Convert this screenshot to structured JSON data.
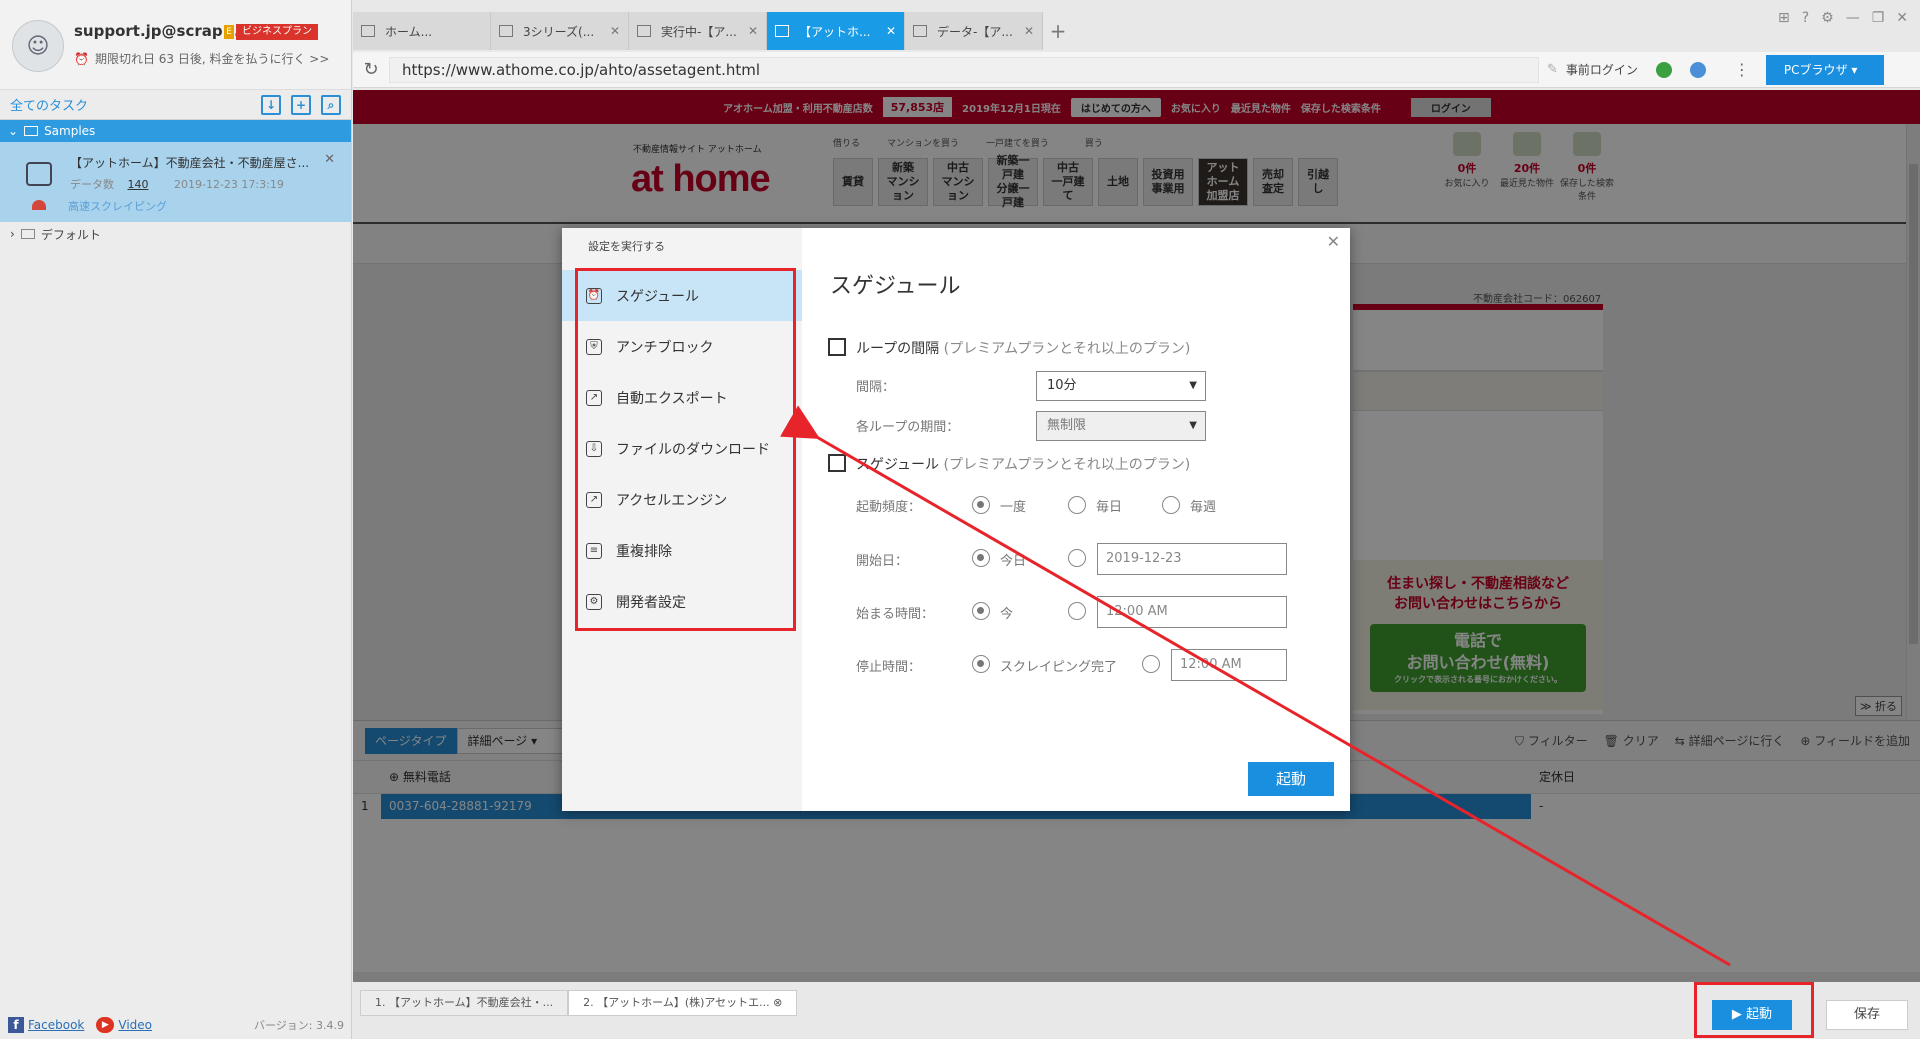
{
  "account": {
    "email": "support.jp@scrap...",
    "plan_tag": "E",
    "plan": "ビジネスプラン",
    "expiry": "期限切れ日 63 日後, 料金を払うに行く >>"
  },
  "sidebar": {
    "all_tasks": "全てのタスク",
    "folder_samples": "Samples",
    "task_name": "【アットホーム】不動産会社・不動産屋さ...",
    "task_data_label": "データ数",
    "task_data_count": "140",
    "task_date": "2019-12-23 17:3:19",
    "task_mode": "高速スクレイピング",
    "folder_default": "デフォルト",
    "footer": {
      "facebook": "Facebook",
      "video": "Video",
      "version": "バージョン: 3.4.9"
    }
  },
  "tabs": [
    {
      "label": "ホーム..."
    },
    {
      "label": "3シリーズ(..."
    },
    {
      "label": "実行中-【ア..."
    },
    {
      "label": "【アットホ..."
    },
    {
      "label": "データ-【ア..."
    }
  ],
  "address": {
    "url": "https://www.athome.co.jp/ahto/assetagent.html",
    "pre_login": "事前ログイン",
    "browser_mode": "PCブラウザ"
  },
  "site": {
    "top_msg": "アオホーム加盟・利用不動産店数",
    "store_count": "57,853店",
    "date_note": "2019年12月1日現在",
    "first_time": "はじめての方へ",
    "favorites": "お気に入り",
    "recent": "最近見た物件",
    "saved_search": "保存した検索条件",
    "login": "ログイン",
    "logo_sub": "不動産情報サイト アットホーム",
    "logo": "at home",
    "nav_header": "借りる　　　マンションを買う　　　一戸建てを買う　　　　買う",
    "nav": [
      "賃貸",
      "新築\nマンション",
      "中古\nマンション",
      "新築一戸建\n分譲一戸建",
      "中古\n一戸建て",
      "土地",
      "投資用\n事業用",
      "アットホーム\n加盟店",
      "売却査定",
      "引越し"
    ],
    "mini": [
      {
        "count": "0件",
        "label": "お気に入り"
      },
      {
        "count": "20件",
        "label": "最近見た物件"
      },
      {
        "count": "0件",
        "label": "保存した検索条件"
      }
    ],
    "corp_code": "不動産会社コード：062607",
    "ad_text": "住まい探し・不動産相談など\nお問い合わせはこちらから",
    "ad_btn": "電話で\nお問い合わせ(無料)",
    "ad_small": "クリックで表示される番号におかけください。",
    "fold": "≫ 折る"
  },
  "data_pane": {
    "page_type": "ページタイプ",
    "detail_page": "詳細ページ",
    "tools": [
      "フィルター",
      "クリア",
      "詳細ページに行く",
      "フィールドを追加"
    ],
    "columns": [
      "無料電話",
      "定休日"
    ],
    "rows": [
      {
        "index": "1",
        "phone": "0037-604-28881-92179",
        "holiday": "-"
      }
    ]
  },
  "bottom_tabs": [
    "1. 【アットホーム】不動産会社・...",
    "2. 【アットホーム】(株)アセットエ..."
  ],
  "buttons": {
    "start": "▶ 起動",
    "save": "保存"
  },
  "dialog": {
    "caption": "設定を実行する",
    "title": "スゲジュール",
    "menu": [
      {
        "label": "スゲジュール",
        "icon": "alarm-clock-icon"
      },
      {
        "label": "アンチブロック",
        "icon": "shield-icon"
      },
      {
        "label": "自動エクスポート",
        "icon": "export-icon"
      },
      {
        "label": "ファイルのダウンロード",
        "icon": "file-download-icon"
      },
      {
        "label": "アクセルエンジン",
        "icon": "chart-icon"
      },
      {
        "label": "重複排除",
        "icon": "dedupe-icon"
      },
      {
        "label": "開発者設定",
        "icon": "gear-icon"
      }
    ],
    "loop_label": "ループの間隔",
    "premium_note": "(プレミアムプランとそれ以上のプラン)",
    "interval_label": "間隔：",
    "interval_value": "10分",
    "period_label": "各ループの期間：",
    "period_value": "無制限",
    "schedule_label": "スゲジュール",
    "freq_label": "起動頻度：",
    "freq_options": [
      "一度",
      "毎日",
      "毎週"
    ],
    "start_date_label": "開始日：",
    "today": "今日",
    "start_date_value": "2019-12-23",
    "start_time_label": "始まる時間：",
    "now": "今",
    "start_time_value": "12:00 AM",
    "stop_time_label": "停止時間：",
    "stop_option": "スクレイピング完了",
    "stop_time_value": "12:00 AM",
    "start_button": "起動"
  },
  "colors": {
    "accent": "#1a8fdf",
    "annotation": "#e8242b",
    "site_red": "#c7002a"
  }
}
